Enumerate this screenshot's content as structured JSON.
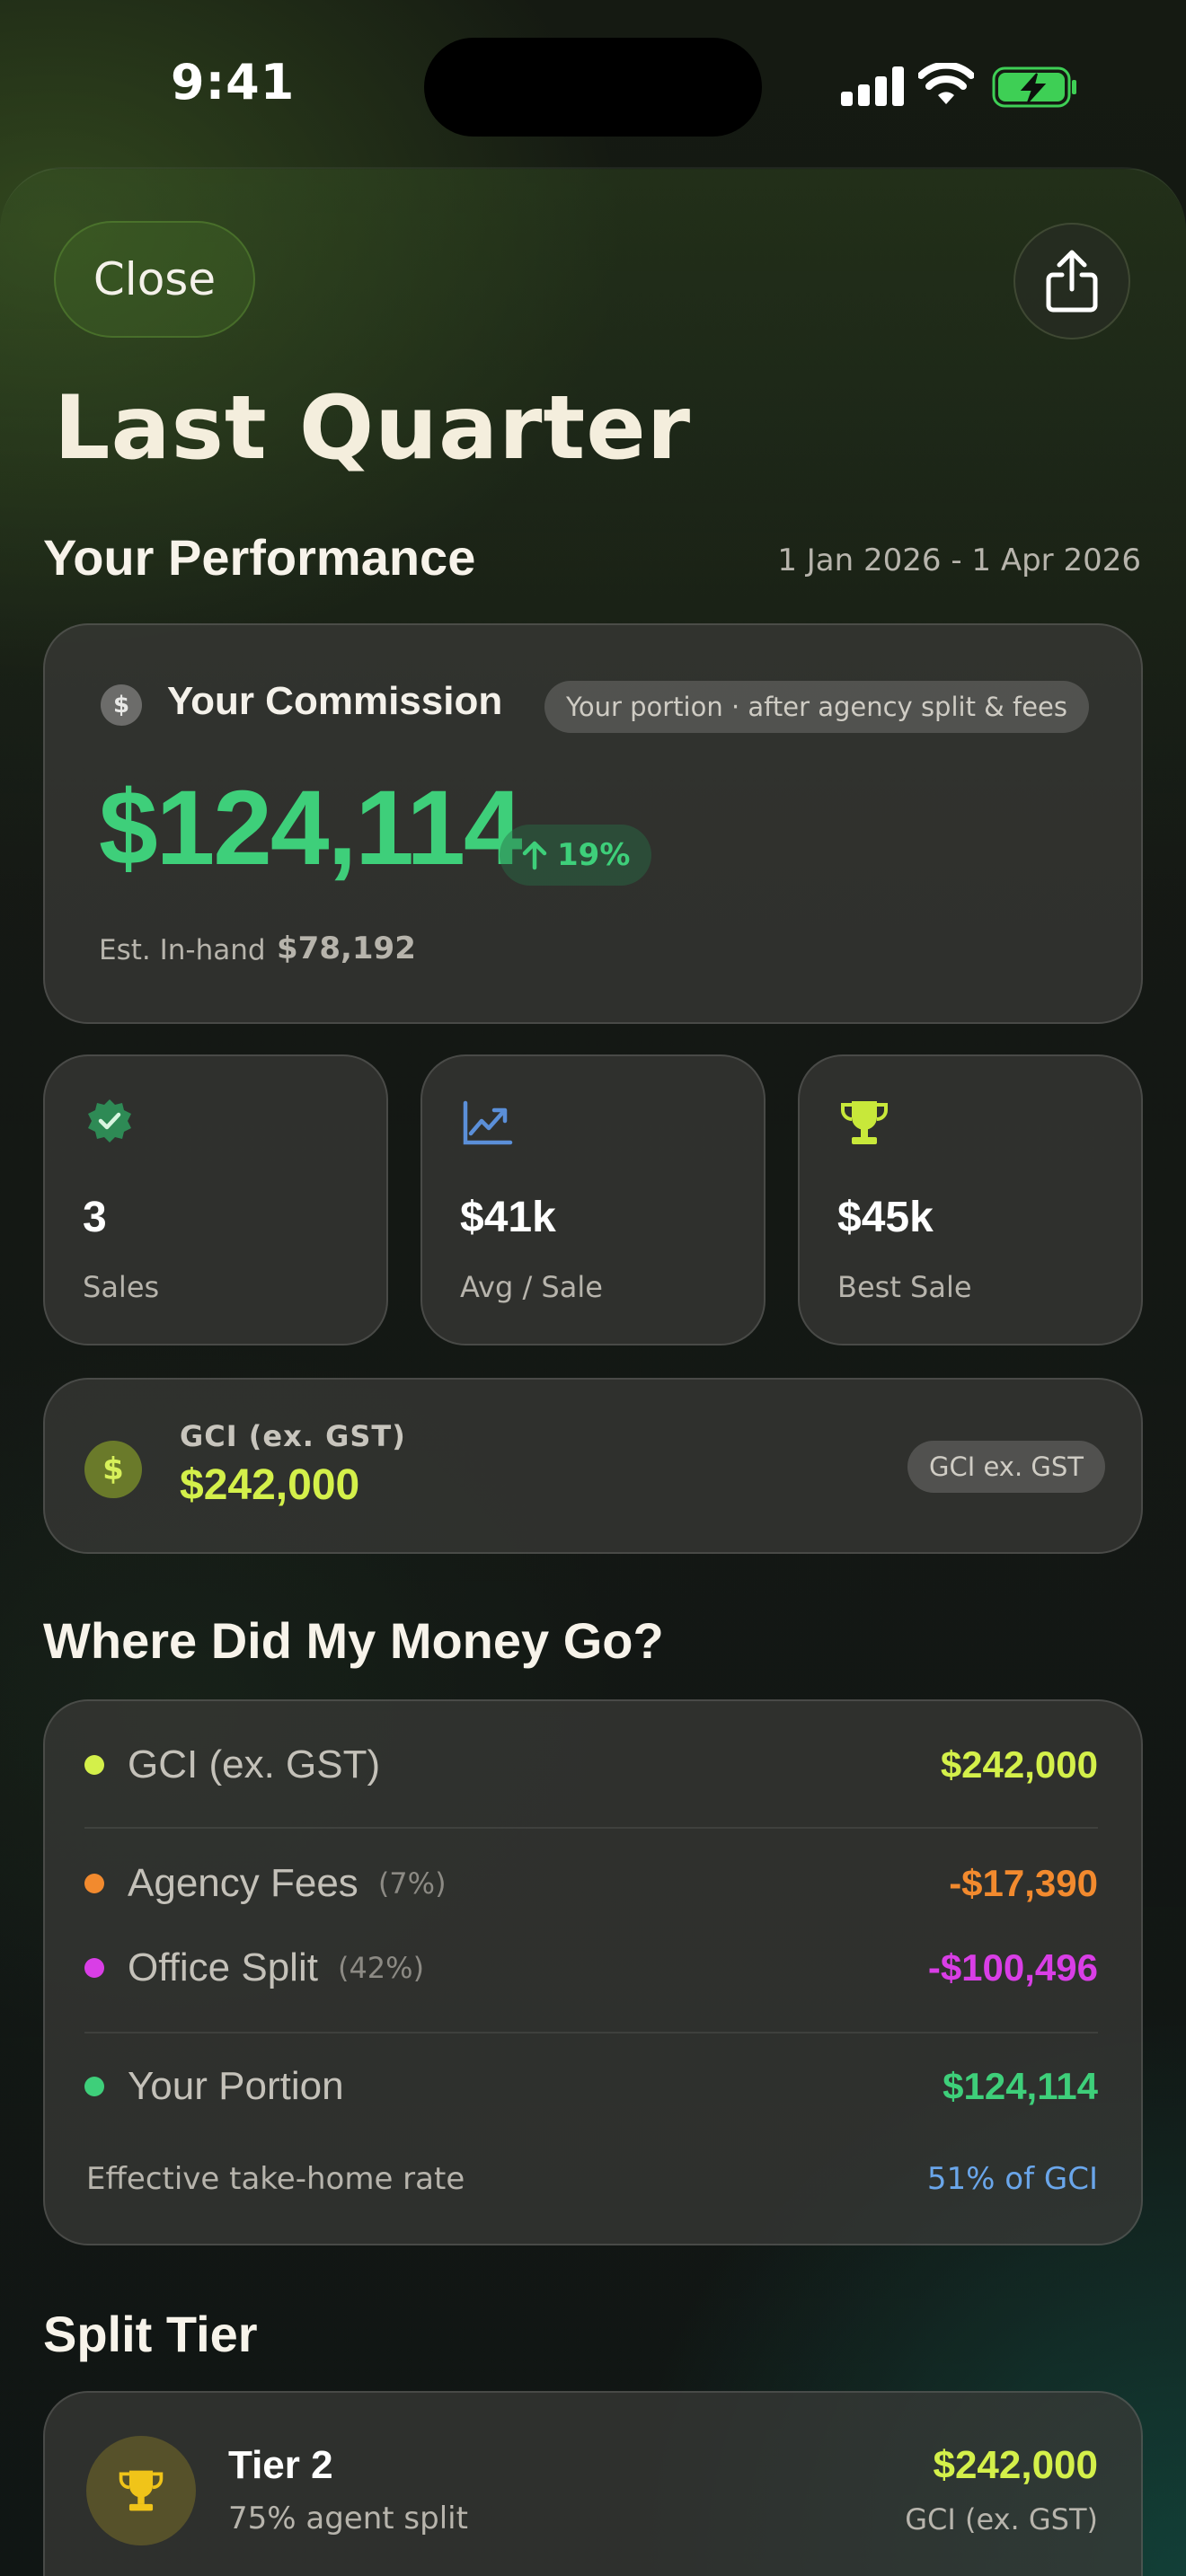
{
  "status_bar": {
    "time": "9:41"
  },
  "header": {
    "close_label": "Close",
    "title": "Last Quarter"
  },
  "performance": {
    "section_title": "Your Performance",
    "date_range": "1 Jan 2026 - 1 Apr 2026",
    "commission": {
      "label": "Your Commission",
      "pill": "Your portion · after agency split & fees",
      "value": "$124,114",
      "change": "19%",
      "inhand_label": "Est. In-hand",
      "inhand_value": "$78,192"
    },
    "stats": [
      {
        "value": "3",
        "label": "Sales",
        "icon": "verified-badge-icon"
      },
      {
        "value": "$41k",
        "label": "Avg / Sale",
        "icon": "trend-chart-icon"
      },
      {
        "value": "$45k",
        "label": "Best Sale",
        "icon": "trophy-icon"
      }
    ],
    "gci": {
      "label": "GCI (ex. GST)",
      "value": "$242,000",
      "pill": "GCI ex. GST"
    }
  },
  "money": {
    "section_title": "Where Did My Money Go?",
    "rows": [
      {
        "name": "GCI (ex. GST)",
        "pct": "",
        "amount": "$242,000",
        "color": "#d4f04a"
      },
      {
        "name": "Agency Fees",
        "pct": "(7%)",
        "amount": "-$17,390",
        "color": "#f28a2e"
      },
      {
        "name": "Office Split",
        "pct": "(42%)",
        "amount": "-$100,496",
        "color": "#d93ee6"
      },
      {
        "name": "Your Portion",
        "pct": "",
        "amount": "$124,114",
        "color": "#3ecf7a"
      }
    ],
    "rate_label": "Effective take-home rate",
    "rate_value": "51% of GCI"
  },
  "split_tier": {
    "section_title": "Split Tier",
    "tier_name": "Tier 2",
    "tier_sub": "75% agent split",
    "amount": "$242,000",
    "amount_sub": "GCI (ex. GST)"
  }
}
